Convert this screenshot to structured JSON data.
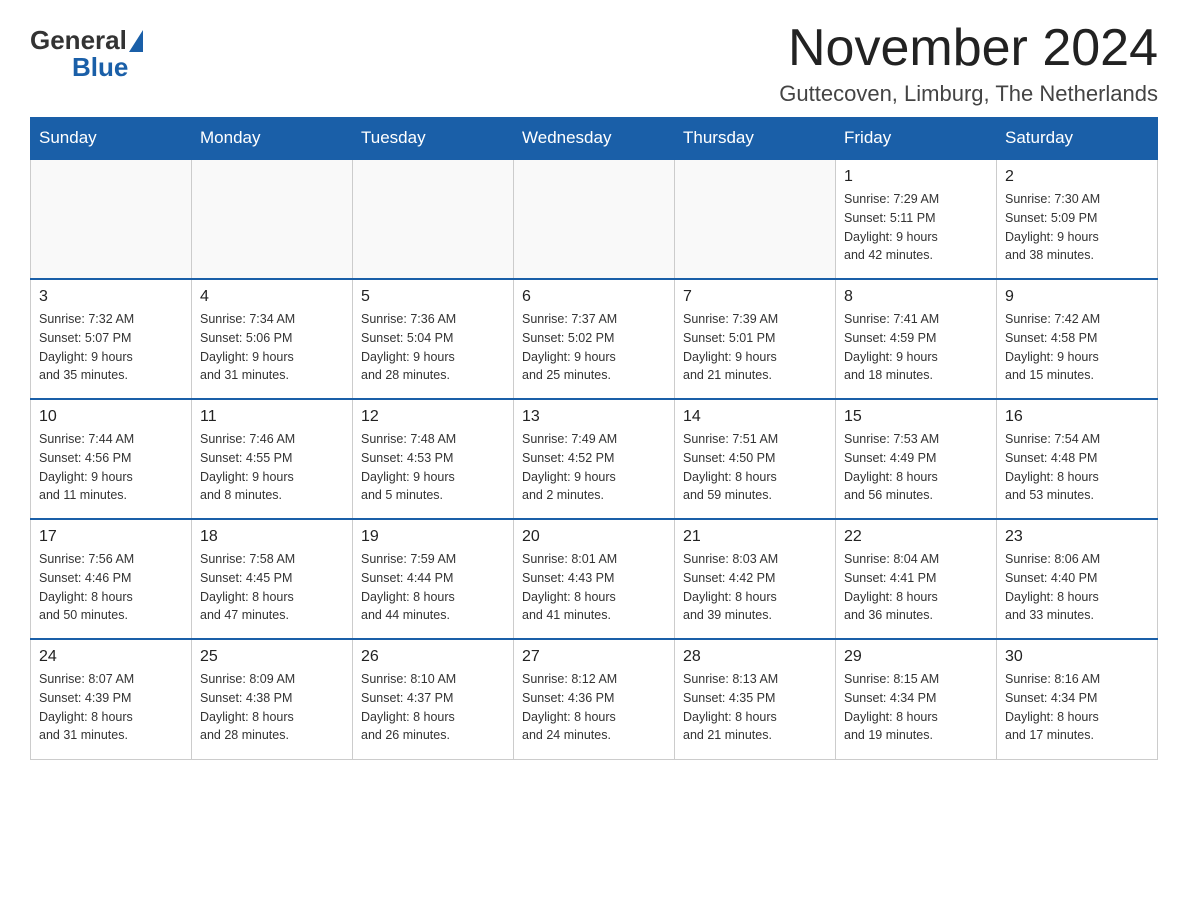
{
  "logo": {
    "general": "General",
    "blue": "Blue"
  },
  "header": {
    "month_title": "November 2024",
    "location": "Guttecoven, Limburg, The Netherlands"
  },
  "weekdays": [
    "Sunday",
    "Monday",
    "Tuesday",
    "Wednesday",
    "Thursday",
    "Friday",
    "Saturday"
  ],
  "weeks": [
    [
      {
        "day": "",
        "info": ""
      },
      {
        "day": "",
        "info": ""
      },
      {
        "day": "",
        "info": ""
      },
      {
        "day": "",
        "info": ""
      },
      {
        "day": "",
        "info": ""
      },
      {
        "day": "1",
        "info": "Sunrise: 7:29 AM\nSunset: 5:11 PM\nDaylight: 9 hours\nand 42 minutes."
      },
      {
        "day": "2",
        "info": "Sunrise: 7:30 AM\nSunset: 5:09 PM\nDaylight: 9 hours\nand 38 minutes."
      }
    ],
    [
      {
        "day": "3",
        "info": "Sunrise: 7:32 AM\nSunset: 5:07 PM\nDaylight: 9 hours\nand 35 minutes."
      },
      {
        "day": "4",
        "info": "Sunrise: 7:34 AM\nSunset: 5:06 PM\nDaylight: 9 hours\nand 31 minutes."
      },
      {
        "day": "5",
        "info": "Sunrise: 7:36 AM\nSunset: 5:04 PM\nDaylight: 9 hours\nand 28 minutes."
      },
      {
        "day": "6",
        "info": "Sunrise: 7:37 AM\nSunset: 5:02 PM\nDaylight: 9 hours\nand 25 minutes."
      },
      {
        "day": "7",
        "info": "Sunrise: 7:39 AM\nSunset: 5:01 PM\nDaylight: 9 hours\nand 21 minutes."
      },
      {
        "day": "8",
        "info": "Sunrise: 7:41 AM\nSunset: 4:59 PM\nDaylight: 9 hours\nand 18 minutes."
      },
      {
        "day": "9",
        "info": "Sunrise: 7:42 AM\nSunset: 4:58 PM\nDaylight: 9 hours\nand 15 minutes."
      }
    ],
    [
      {
        "day": "10",
        "info": "Sunrise: 7:44 AM\nSunset: 4:56 PM\nDaylight: 9 hours\nand 11 minutes."
      },
      {
        "day": "11",
        "info": "Sunrise: 7:46 AM\nSunset: 4:55 PM\nDaylight: 9 hours\nand 8 minutes."
      },
      {
        "day": "12",
        "info": "Sunrise: 7:48 AM\nSunset: 4:53 PM\nDaylight: 9 hours\nand 5 minutes."
      },
      {
        "day": "13",
        "info": "Sunrise: 7:49 AM\nSunset: 4:52 PM\nDaylight: 9 hours\nand 2 minutes."
      },
      {
        "day": "14",
        "info": "Sunrise: 7:51 AM\nSunset: 4:50 PM\nDaylight: 8 hours\nand 59 minutes."
      },
      {
        "day": "15",
        "info": "Sunrise: 7:53 AM\nSunset: 4:49 PM\nDaylight: 8 hours\nand 56 minutes."
      },
      {
        "day": "16",
        "info": "Sunrise: 7:54 AM\nSunset: 4:48 PM\nDaylight: 8 hours\nand 53 minutes."
      }
    ],
    [
      {
        "day": "17",
        "info": "Sunrise: 7:56 AM\nSunset: 4:46 PM\nDaylight: 8 hours\nand 50 minutes."
      },
      {
        "day": "18",
        "info": "Sunrise: 7:58 AM\nSunset: 4:45 PM\nDaylight: 8 hours\nand 47 minutes."
      },
      {
        "day": "19",
        "info": "Sunrise: 7:59 AM\nSunset: 4:44 PM\nDaylight: 8 hours\nand 44 minutes."
      },
      {
        "day": "20",
        "info": "Sunrise: 8:01 AM\nSunset: 4:43 PM\nDaylight: 8 hours\nand 41 minutes."
      },
      {
        "day": "21",
        "info": "Sunrise: 8:03 AM\nSunset: 4:42 PM\nDaylight: 8 hours\nand 39 minutes."
      },
      {
        "day": "22",
        "info": "Sunrise: 8:04 AM\nSunset: 4:41 PM\nDaylight: 8 hours\nand 36 minutes."
      },
      {
        "day": "23",
        "info": "Sunrise: 8:06 AM\nSunset: 4:40 PM\nDaylight: 8 hours\nand 33 minutes."
      }
    ],
    [
      {
        "day": "24",
        "info": "Sunrise: 8:07 AM\nSunset: 4:39 PM\nDaylight: 8 hours\nand 31 minutes."
      },
      {
        "day": "25",
        "info": "Sunrise: 8:09 AM\nSunset: 4:38 PM\nDaylight: 8 hours\nand 28 minutes."
      },
      {
        "day": "26",
        "info": "Sunrise: 8:10 AM\nSunset: 4:37 PM\nDaylight: 8 hours\nand 26 minutes."
      },
      {
        "day": "27",
        "info": "Sunrise: 8:12 AM\nSunset: 4:36 PM\nDaylight: 8 hours\nand 24 minutes."
      },
      {
        "day": "28",
        "info": "Sunrise: 8:13 AM\nSunset: 4:35 PM\nDaylight: 8 hours\nand 21 minutes."
      },
      {
        "day": "29",
        "info": "Sunrise: 8:15 AM\nSunset: 4:34 PM\nDaylight: 8 hours\nand 19 minutes."
      },
      {
        "day": "30",
        "info": "Sunrise: 8:16 AM\nSunset: 4:34 PM\nDaylight: 8 hours\nand 17 minutes."
      }
    ]
  ]
}
